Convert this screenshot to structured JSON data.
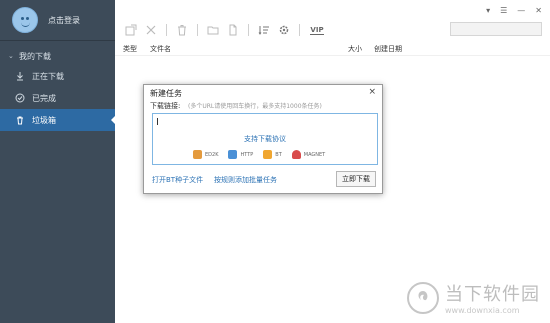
{
  "sidebar": {
    "login_label": "点击登录",
    "group_label": "我的下载",
    "items": [
      {
        "label": "正在下载",
        "icon": "download-icon"
      },
      {
        "label": "已完成",
        "icon": "check-circle-icon"
      },
      {
        "label": "垃圾箱",
        "icon": "trash-icon"
      }
    ]
  },
  "toolbar": {
    "vip_label": "VIP"
  },
  "table": {
    "columns": [
      "类型",
      "文件名",
      "大小",
      "创建日期"
    ]
  },
  "dialog": {
    "title": "新建任务",
    "close": "×",
    "label": "下载链接:",
    "hint": "(多个URL请使用回车换行，最多支持1000条任务)",
    "protocol_title": "支持下载协议",
    "protocols": [
      "ED2K",
      "HTTP",
      "BT",
      "MAGNET"
    ],
    "link_torrent": "打开BT种子文件",
    "link_batch": "按规则添加批量任务",
    "download_button": "立即下载"
  },
  "watermark": {
    "title": "当下软件园",
    "url": "www.downxia.com"
  },
  "colors": {
    "sidebar_bg": "#3d4b59",
    "active_item": "#2d6aa3",
    "link": "#2d73b5"
  }
}
